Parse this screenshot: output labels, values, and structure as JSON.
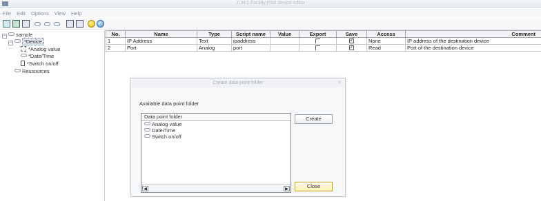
{
  "window": {
    "title": "JUNG Facility Pilot device editor"
  },
  "menu": [
    "File",
    "Edit",
    "Options",
    "View",
    "Help"
  ],
  "tree": {
    "root": "sample",
    "device": "*Device",
    "children": [
      "*Analog value",
      "*Date/Time",
      "*Switch on/off"
    ],
    "resources": "Ressources"
  },
  "table": {
    "headers": [
      "No.",
      "Name",
      "Type",
      "Script name",
      "Value",
      "Export",
      "Save",
      "Access",
      "Comment"
    ],
    "rows": [
      {
        "no": "1",
        "name": "IP Address",
        "type": "Text",
        "script": "ipaddress",
        "value": "",
        "export": false,
        "save": true,
        "access": "None",
        "comment": "IP address of the destination device"
      },
      {
        "no": "2",
        "name": "Port",
        "type": "Analog",
        "script": "port",
        "value": "",
        "export": false,
        "save": true,
        "access": "Read",
        "comment": "Port of the destination device"
      }
    ]
  },
  "dialog": {
    "title": "Create data point folder",
    "close_x": "×",
    "label": "Available data point folder",
    "list_header": "Data point folder",
    "items": [
      "Analog value",
      "Date/Time",
      "Switch on/off"
    ],
    "create_label": "Create",
    "close_label": "Close",
    "scroll_left": "◀",
    "scroll_right": "▶"
  }
}
